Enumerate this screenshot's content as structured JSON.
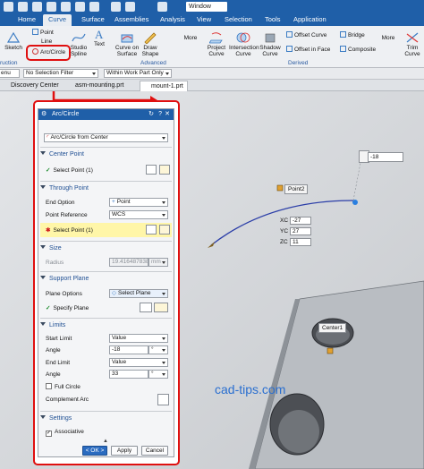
{
  "titlebar": {
    "window_menu": "Window"
  },
  "menu_tabs": [
    "Home",
    "Curve",
    "Surface",
    "Assemblies",
    "Analysis",
    "View",
    "Selection",
    "Tools",
    "Application"
  ],
  "active_tab": "Curve",
  "ribbon": {
    "point": "Point",
    "line": "Line",
    "arc_circle": "Arc/Circle",
    "sketch": "Sketch",
    "studio_spline_1": "Studio",
    "studio_spline_2": "Spline",
    "text": "Text",
    "curve_on_surface_1": "Curve on",
    "curve_on_surface_2": "Surface",
    "draw_shape_1": "Draw",
    "draw_shape_2": "Shape",
    "more": "More",
    "project_curve_1": "Project",
    "project_curve_2": "Curve",
    "intersection_curve_1": "Intersection",
    "intersection_curve_2": "Curve",
    "shadow_curve_1": "Shadow",
    "shadow_curve_2": "Curve",
    "offset_curve": "Offset Curve",
    "offset_in_face": "Offset in Face",
    "bridge": "Bridge",
    "composite": "Composite",
    "more2": "More",
    "trim_curve_1": "Trim",
    "trim_curve_2": "Curve",
    "group_construction": "ruction",
    "group_advanced": "Advanced",
    "group_derived": "Derived"
  },
  "filterbar": {
    "menu": "enu",
    "selection_filter": "No Selection Filter",
    "scope": "Within Work Part Only"
  },
  "doc_tabs": [
    "Discovery Center",
    "asm-mounting.prt",
    "mount-1.prt"
  ],
  "dialog": {
    "title": "Arc/Circle",
    "type_value": "Arc/Circle from Center",
    "center_point": {
      "header": "Center Point",
      "select": "Select Point (1)"
    },
    "through_point": {
      "header": "Through Point",
      "end_option_label": "End Option",
      "end_option_value": "Point",
      "point_reference_label": "Point Reference",
      "point_reference_value": "WCS",
      "select": "Select Point (1)"
    },
    "size": {
      "header": "Size",
      "radius_label": "Radius",
      "radius_value": "19.4164878388",
      "radius_unit": "mm"
    },
    "support_plane": {
      "header": "Support Plane",
      "plane_options_label": "Plane Options",
      "plane_options_value": "Select Plane",
      "specify": "Specify Plane"
    },
    "limits": {
      "header": "Limits",
      "start_limit_label": "Start Limit",
      "start_limit_value": "Value",
      "angle1_label": "Angle",
      "angle1_value": "-18",
      "angle1_unit": "°",
      "end_limit_label": "End Limit",
      "end_limit_value": "Value",
      "angle2_label": "Angle",
      "angle2_value": "33",
      "angle2_unit": "°",
      "full_circle": "Full Circle",
      "complement_arc": "Complement Arc"
    },
    "settings": {
      "header": "Settings",
      "associative": "Associative"
    },
    "buttons": {
      "ok": "< OK >",
      "apply": "Apply",
      "cancel": "Cancel"
    }
  },
  "viewport": {
    "angle_input": "-18",
    "point2_label": "Point2",
    "xc_label": "XC",
    "xc_value": "-27",
    "yc_label": "YC",
    "yc_value": "27",
    "zc_label": "ZC",
    "zc_value": "11",
    "center1_label": "Center1",
    "watermark": "cad-tips.com"
  },
  "colors": {
    "accent": "#1f5fa8",
    "highlight": "#e01010",
    "selection_yellow": "#fff6a8",
    "watermark": "#2a6fd0"
  }
}
